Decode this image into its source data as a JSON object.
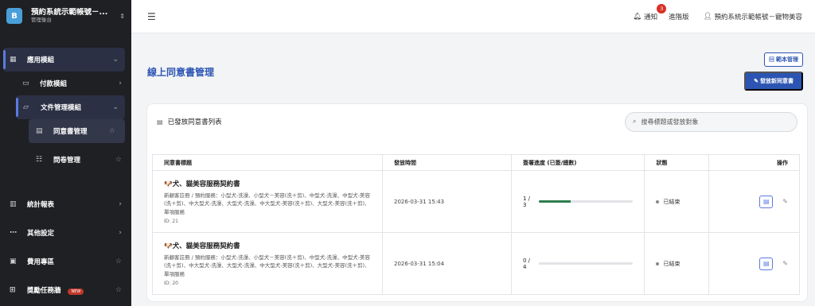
{
  "brand": {
    "logo": "B",
    "title": "預約系統示範帳號－...",
    "subtitle": "管理後台"
  },
  "sidebar": {
    "items": [
      {
        "label": "應用模組",
        "icon": "grid-icon",
        "tail": "⌄"
      },
      {
        "label": "付款模組",
        "icon": "card-icon",
        "tail": "›"
      },
      {
        "label": "文件管理模組",
        "icon": "folder-icon",
        "tail": "⌄"
      },
      {
        "label": "同意書管理",
        "icon": "document-icon",
        "tail": "☆"
      },
      {
        "label": "問卷管理",
        "icon": "list-icon",
        "tail": "☆"
      },
      {
        "label": "統計報表",
        "icon": "chart-icon",
        "tail": "›"
      },
      {
        "label": "其他設定",
        "icon": "more-icon",
        "tail": "›"
      },
      {
        "label": "費用專區",
        "icon": "terminal-icon",
        "tail": "☆"
      },
      {
        "label": "獎勵任務牆",
        "icon": "gift-icon",
        "tail": "☆",
        "badge": "NEW"
      }
    ]
  },
  "topbar": {
    "notify_label": "通知",
    "notify_count": "3",
    "advanced_label": "進階版",
    "user_label": "預約系統示範帳號－寵物美容"
  },
  "main": {
    "title": "線上同意書管理",
    "template_button": "範本管理",
    "issue_button": "發放新同意書"
  },
  "card": {
    "title": "已發放同意書列表",
    "search_placeholder": "搜尋標題或發放對象",
    "columns": [
      "同意書標題",
      "發放時間",
      "簽署進度 (已簽/總數)",
      "狀態",
      "操作"
    ],
    "rows": [
      {
        "title": "🐶犬、貓美容服務契約書",
        "desc": "新顧客註冊 / 預約服務：小型犬-洗澡、小型犬－美容(洗＋剪)、中型犬-洗澡、中型犬-美容(洗＋剪)、中大型犬-洗澡、大型犬-洗澡、中大型犬-美容(洗＋剪)、大型犬-美容(洗＋剪)、單項服務",
        "id": "ID: 21",
        "time": "2026-03-31 15:43",
        "progress_text": "1 / 3",
        "progress": 0.333,
        "status": "已結束"
      },
      {
        "title": "🐶犬、貓美容服務契約書",
        "desc": "新顧客註冊 / 預約服務：小型犬-洗澡、小型犬－美容(洗＋剪)、中型犬-洗澡、中型犬-美容(洗＋剪)、中大型犬-洗澡、大型犬-洗澡、中大型犬-美容(洗＋剪)、大型犬-美容(洗＋剪)、單項服務",
        "id": "ID: 20",
        "time": "2026-03-31 15:04",
        "progress_text": "0 / 4",
        "progress": 0,
        "status": "已結束"
      }
    ]
  },
  "colors": {
    "accent": "#2c55b3",
    "progress": "#2f7d4f",
    "sidebar_bg": "#1f2024"
  }
}
